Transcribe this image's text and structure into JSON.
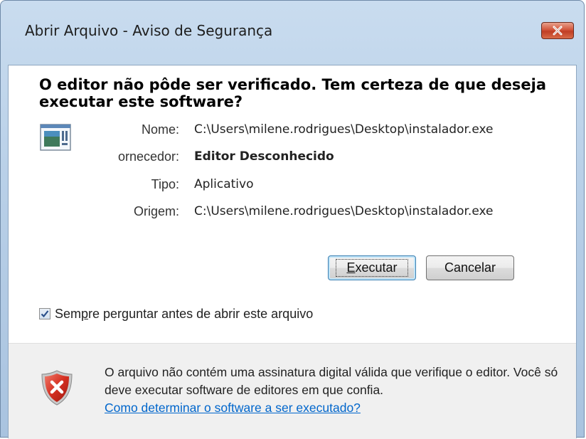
{
  "window": {
    "title": "Abrir Arquivo - Aviso de Segurança"
  },
  "dialog": {
    "headline": "O editor não pôde ser verificado. Tem certeza de que deseja executar este software?",
    "fields": [
      {
        "label": "Nome:",
        "value": "C:\\Users\\milene.rodrigues\\Desktop\\instalador.exe"
      },
      {
        "label": "ornecedor:",
        "value": "Editor Desconhecido"
      },
      {
        "label": "Tipo:",
        "value": "Aplicativo"
      },
      {
        "label": "Origem:",
        "value": "C:\\Users\\milene.rodrigues\\Desktop\\instalador.exe"
      }
    ],
    "buttons": {
      "run_label_accel": "E",
      "run_label_rest": "xecutar",
      "cancel_label": "Cancelar"
    },
    "checkbox": {
      "checked": true,
      "label_pre": "Sem",
      "label_accel": "p",
      "label_post": "re perguntar antes de abrir este arquivo"
    }
  },
  "footer": {
    "warning_text": "O arquivo não contém uma assinatura digital válida que verifique o editor. Você só deve executar software de editores em que confia.",
    "link_text": "Como determinar o software a ser executado?"
  },
  "icons": {
    "close": "close-icon",
    "app": "application-icon",
    "shield": "shield-error-icon",
    "check": "checkmark-icon"
  },
  "colors": {
    "titlebar": "#b9d0e8",
    "close_button": "#c03e24",
    "link": "#0066cc",
    "footer_bg": "#f0f0f0"
  }
}
